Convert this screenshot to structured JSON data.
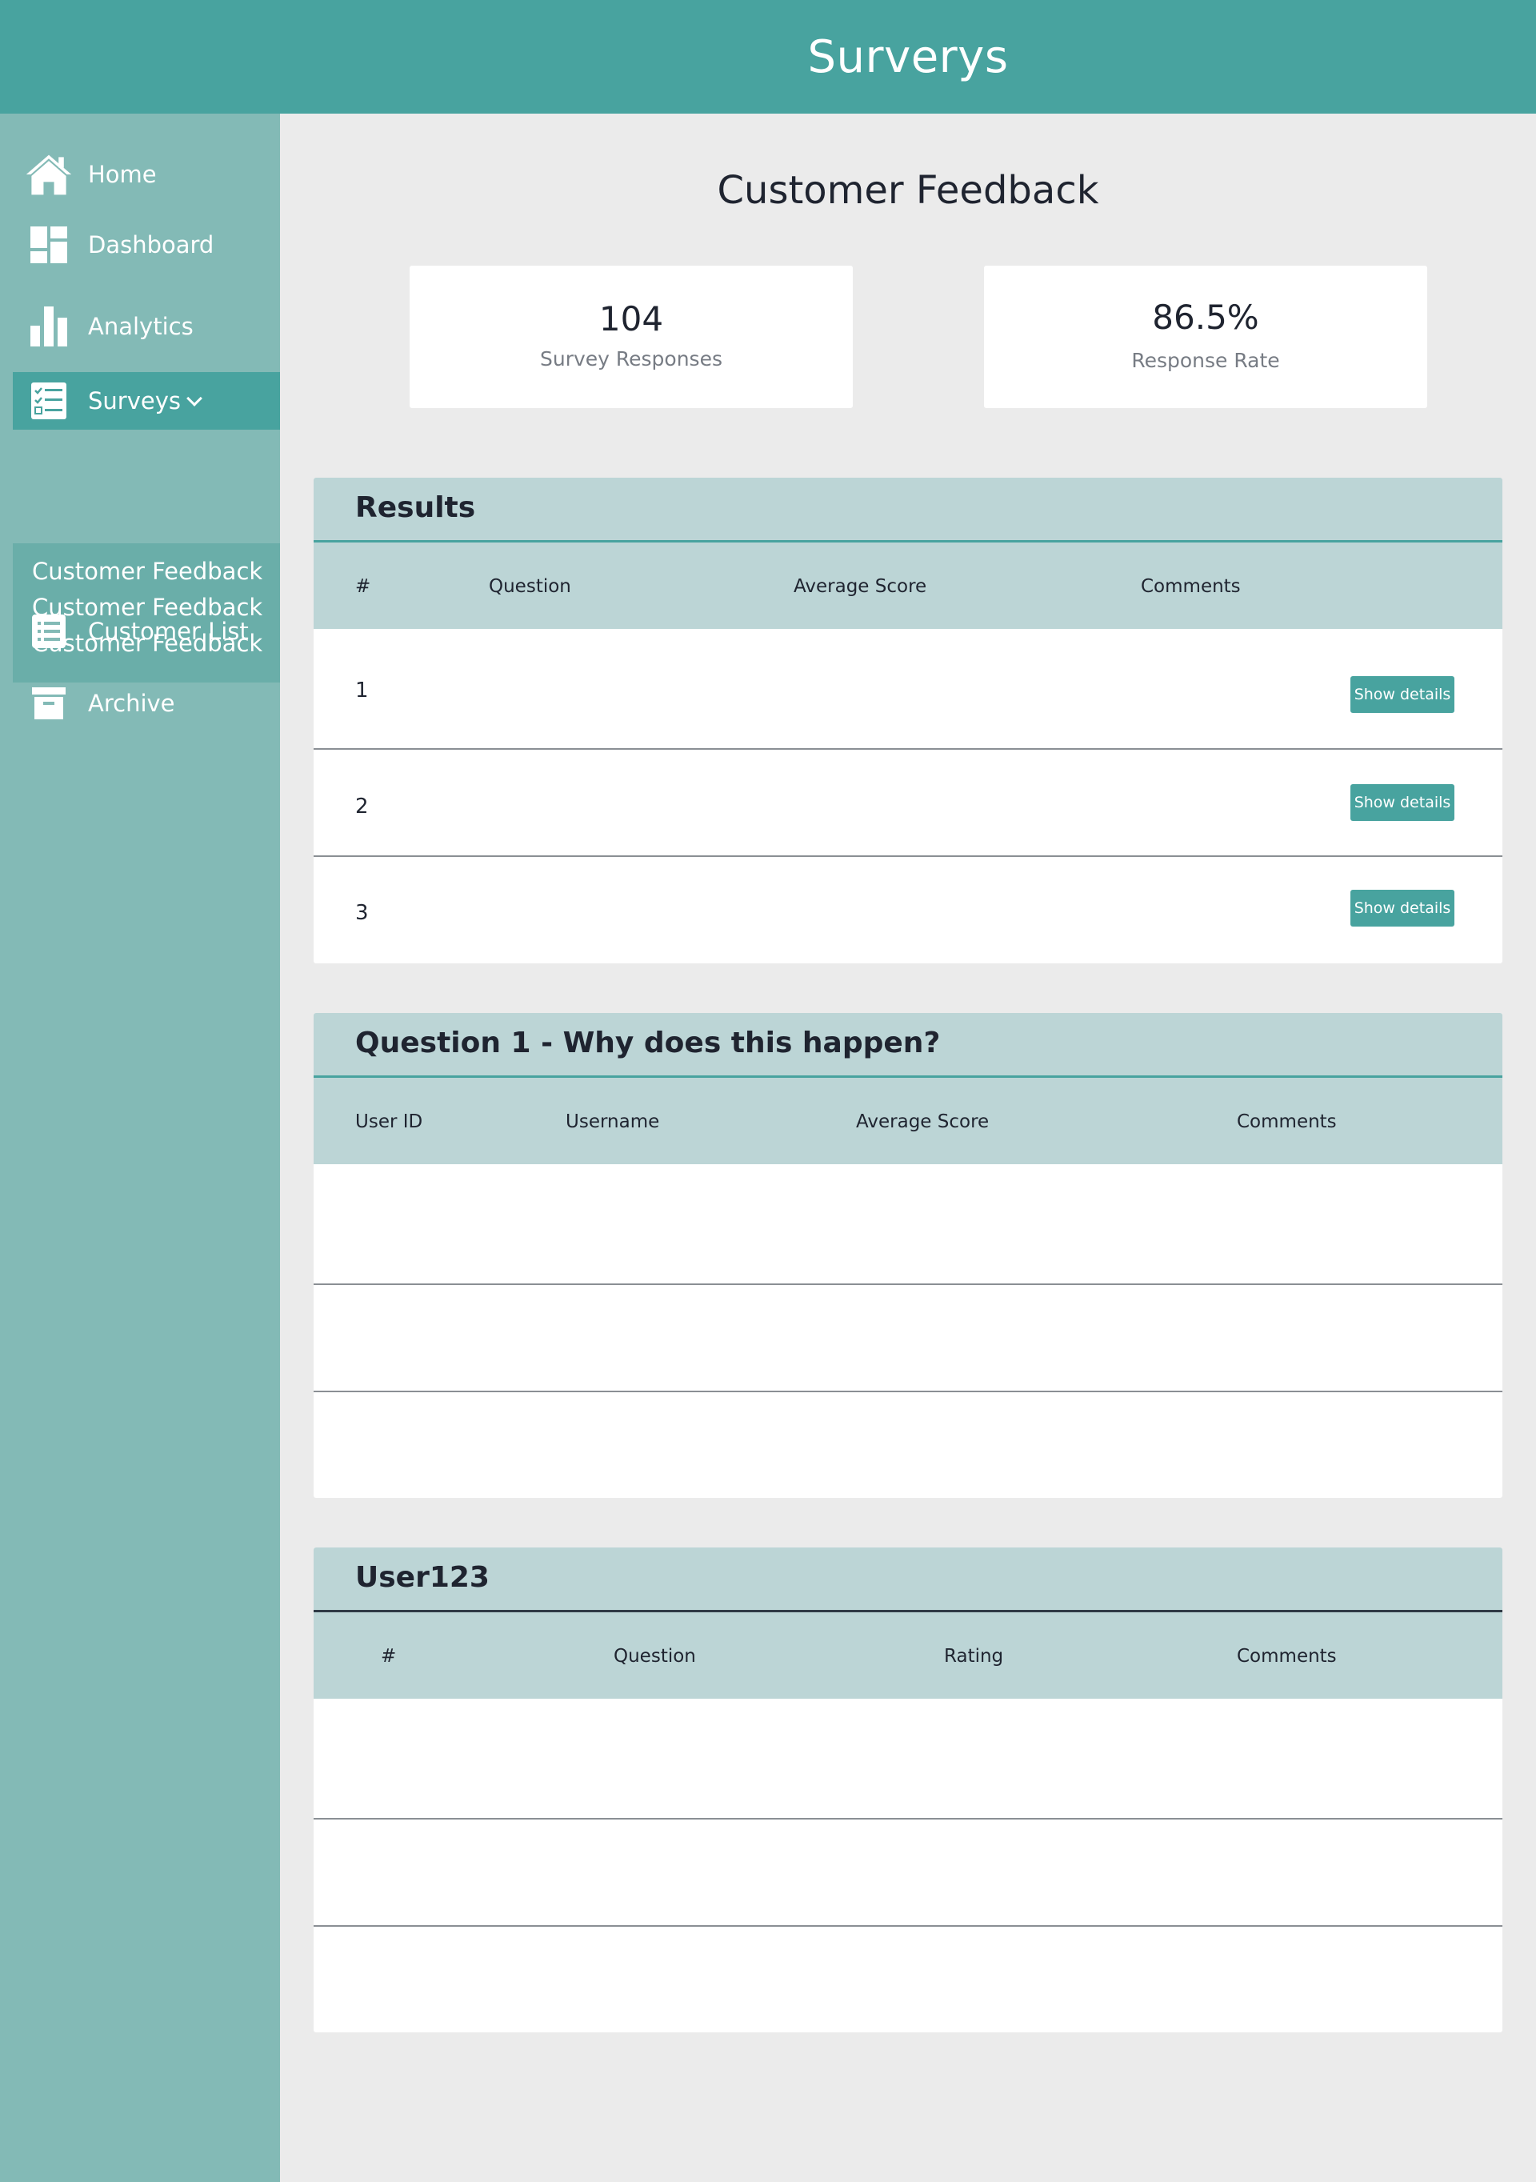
{
  "header": {
    "app_title": "Surverys"
  },
  "sidebar": {
    "items": [
      {
        "label": "Home",
        "icon": "home-icon"
      },
      {
        "label": "Dashboard",
        "icon": "dashboard-icon"
      },
      {
        "label": "Analytics",
        "icon": "bar-chart-icon"
      },
      {
        "label": "Surveys",
        "icon": "checklist-icon",
        "active": true
      },
      {
        "label": "Customer List",
        "icon": "list-icon"
      },
      {
        "label": "Archive",
        "icon": "archive-icon"
      }
    ],
    "surveys_submenu": [
      "Customer Feedback",
      "Customer Feedback",
      "Customer Feedback"
    ]
  },
  "main": {
    "page_title": "Customer Feedback",
    "stats": [
      {
        "value": "104",
        "label": "Survey Responses"
      },
      {
        "value": "86.5%",
        "label": "Response Rate"
      }
    ],
    "results_panel": {
      "title": "Results",
      "columns": [
        "#",
        "Question",
        "Average Score",
        "Comments"
      ],
      "rows": [
        {
          "num": "1",
          "button": "Show details"
        },
        {
          "num": "2",
          "button": "Show details"
        },
        {
          "num": "3",
          "button": "Show details"
        }
      ]
    },
    "question_panel": {
      "title": "Question 1 - Why does this happen?",
      "columns": [
        "User ID",
        "Username",
        "Average Score",
        "Comments"
      ]
    },
    "user_panel": {
      "title": "User123",
      "columns": [
        "#",
        "Question",
        "Rating",
        "Comments"
      ]
    }
  },
  "colors": {
    "accent": "#48a39f",
    "sidebar": "#83bab6",
    "submenu": "#6aaea9",
    "panel_header": "#bcd5d6",
    "background": "#ebebeb"
  }
}
